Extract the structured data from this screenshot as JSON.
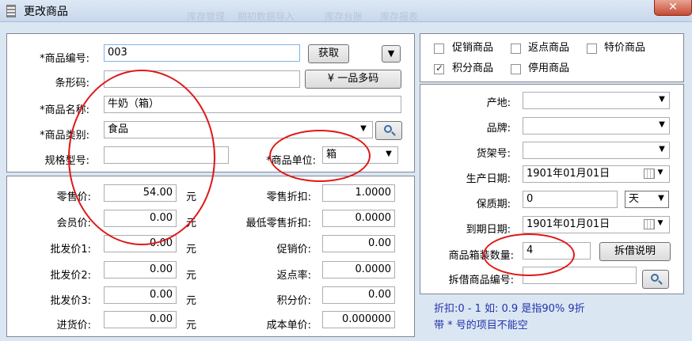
{
  "window": {
    "title": "更改商品",
    "ghost_tabs": [
      "库存管理",
      "期初数据导入",
      "库存台账",
      "库存报表"
    ],
    "close_label": "✕"
  },
  "left_top": {
    "code_label": "*商品编号:",
    "code_value": "003",
    "fetch_button": "获取",
    "barcode_label": "条形码:",
    "multi_button": "¥ 一品多码",
    "name_label": "*商品名称:",
    "name_value": "牛奶（箱）",
    "category_label": "*商品类别:",
    "category_value": "食品",
    "spec_label": "规格型号:",
    "spec_value": "",
    "unit_label": "*商品单位:",
    "unit_value": "箱"
  },
  "left_prices": {
    "left": [
      {
        "label": "零售价:",
        "value": "54.00",
        "unit": "元"
      },
      {
        "label": "会员价:",
        "value": "0.00",
        "unit": "元"
      },
      {
        "label": "批发价1:",
        "value": "0.00",
        "unit": "元"
      },
      {
        "label": "批发价2:",
        "value": "0.00",
        "unit": "元"
      },
      {
        "label": "批发价3:",
        "value": "0.00",
        "unit": "元"
      },
      {
        "label": "进货价:",
        "value": "0.00",
        "unit": "元"
      }
    ],
    "right": [
      {
        "label": "零售折扣:",
        "value": "1.0000"
      },
      {
        "label": "最低零售折扣:",
        "value": "0.0000"
      },
      {
        "label": "促销价:",
        "value": "0.00"
      },
      {
        "label": "返点率:",
        "value": "0.0000"
      },
      {
        "label": "积分价:",
        "value": "0.00"
      },
      {
        "label": "成本单价:",
        "value": "0.000000"
      }
    ]
  },
  "checkboxes": [
    {
      "label": "促销商品",
      "checked": false
    },
    {
      "label": "返点商品",
      "checked": false
    },
    {
      "label": "特价商品",
      "checked": false
    },
    {
      "label": "积分商品",
      "checked": true
    },
    {
      "label": "停用商品",
      "checked": false
    }
  ],
  "right_fields": {
    "origin_label": "产地:",
    "origin_value": "",
    "brand_label": "品牌:",
    "brand_value": "",
    "shelf_label": "货架号:",
    "shelf_value": "",
    "prod_date_label": "生产日期:",
    "prod_date_value": "1901年01月01日",
    "shelf_life_label": "保质期:",
    "shelf_life_value": "0",
    "shelf_life_unit": "天",
    "expire_label": "到期日期:",
    "expire_value": "1901年01月01日",
    "box_qty_label": "商品箱装数量:",
    "box_qty_value": "4",
    "split_button": "拆借说明",
    "split_code_label": "拆借商品编号:",
    "split_code_value": ""
  },
  "info": {
    "line1": "折扣:0 - 1  如:  0.9 是指90%  9折",
    "line2": "带 * 号的项目不能空"
  },
  "colors": {
    "annotation": "#e01818",
    "info_text": "#2233aa",
    "info_bg": "#dbe6f3"
  }
}
